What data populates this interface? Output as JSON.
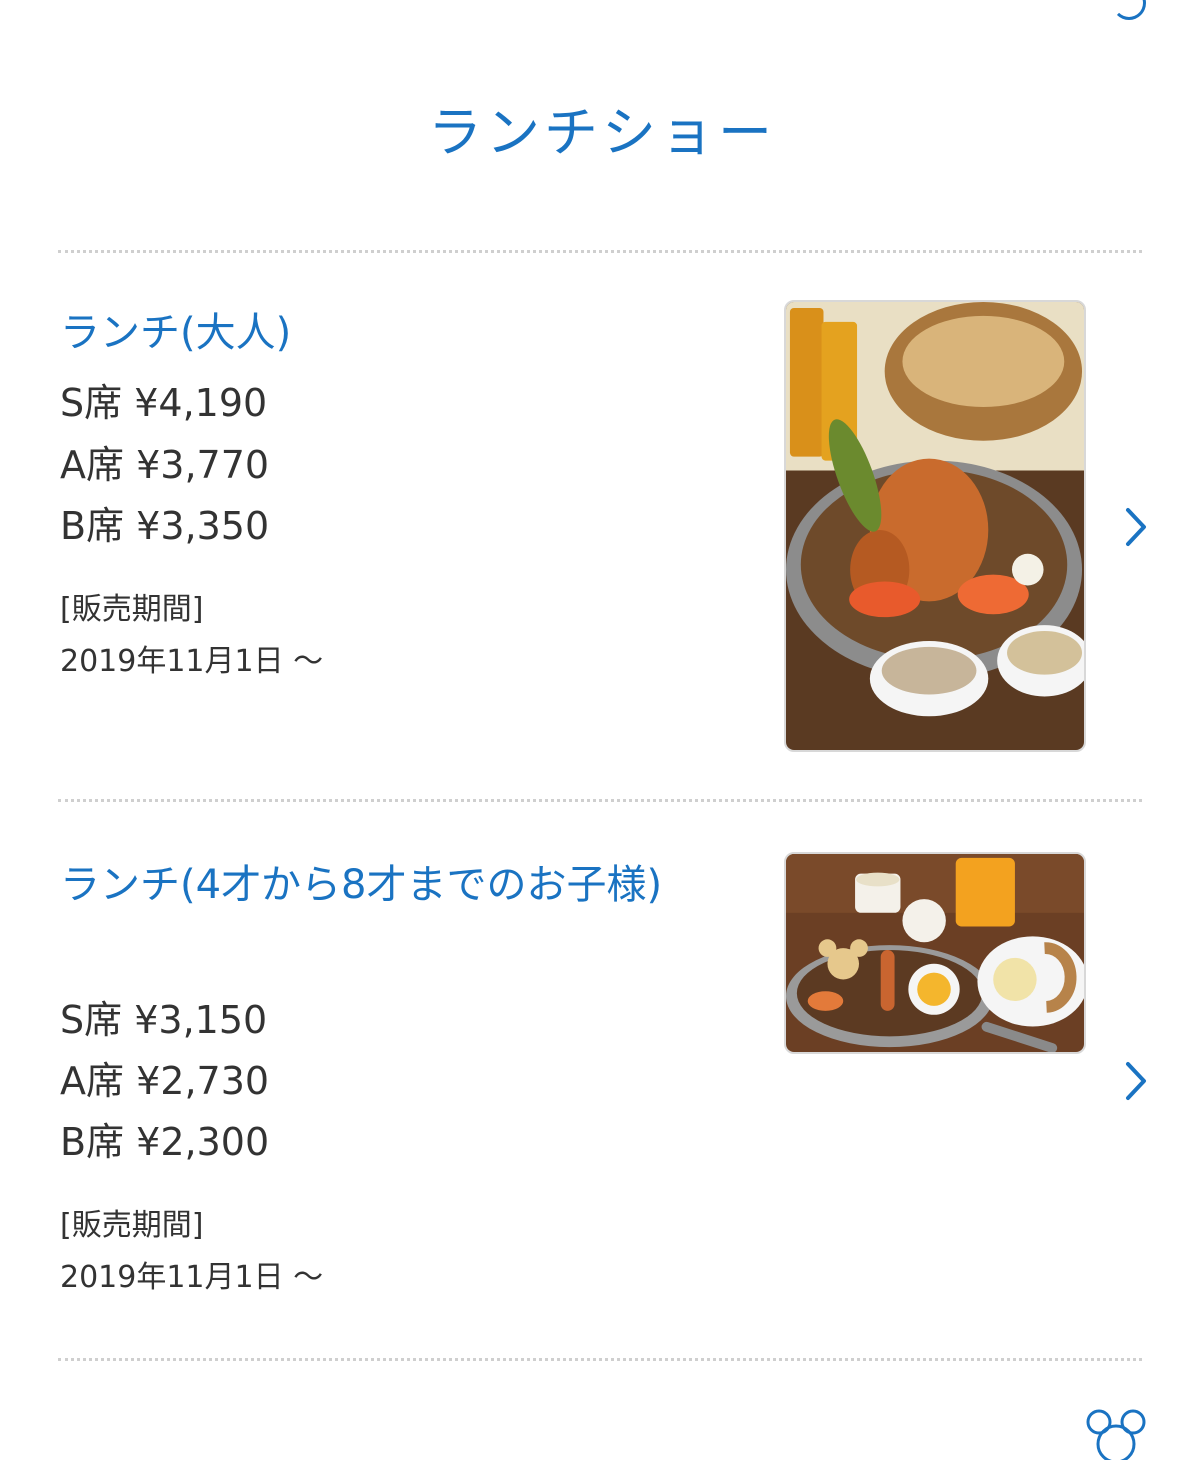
{
  "header": {
    "title": "ランチショー"
  },
  "colors": {
    "accent": "#1a73c2",
    "text": "#333333",
    "divider": "#cfcfcf"
  },
  "items": [
    {
      "name": "ランチ(大人)",
      "prices": [
        {
          "seat": "S席",
          "price": "¥4,190"
        },
        {
          "seat": "A席",
          "price": "¥3,770"
        },
        {
          "seat": "B席",
          "price": "¥3,350"
        }
      ],
      "period_label": "[販売期間]",
      "period_date": "2019年11月1日 ～",
      "image_icon": "food-photo-adult-lunch",
      "chevron_icon": "chevron-right-icon"
    },
    {
      "name": "ランチ(4才から8才までのお子様)",
      "prices": [
        {
          "seat": "S席",
          "price": "¥3,150"
        },
        {
          "seat": "A席",
          "price": "¥2,730"
        },
        {
          "seat": "B席",
          "price": "¥2,300"
        }
      ],
      "period_label": "[販売期間]",
      "period_date": "2019年11月1日 ～",
      "image_icon": "food-photo-kids-lunch",
      "chevron_icon": "chevron-right-icon"
    }
  ],
  "footer": {
    "icon": "mickey-icon"
  }
}
